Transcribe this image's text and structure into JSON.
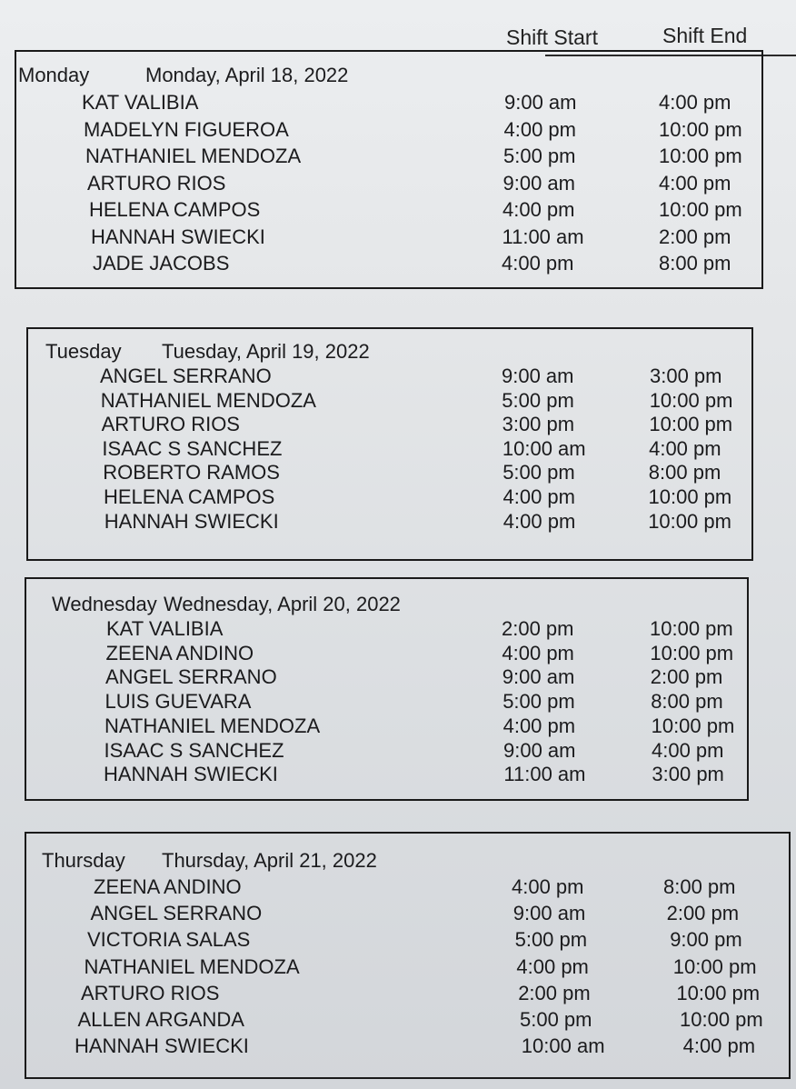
{
  "columns": {
    "start": "Shift Start",
    "end": "Shift End"
  },
  "days": [
    {
      "day": "Monday",
      "date": "Monday, April 18, 2022",
      "rows": [
        {
          "name": "KAT VALIBIA",
          "start": "9:00 am",
          "end": "4:00 pm"
        },
        {
          "name": "MADELYN FIGUEROA",
          "start": "4:00 pm",
          "end": "10:00 pm"
        },
        {
          "name": "NATHANIEL MENDOZA",
          "start": "5:00 pm",
          "end": "10:00 pm"
        },
        {
          "name": "ARTURO RIOS",
          "start": "9:00 am",
          "end": "4:00 pm"
        },
        {
          "name": "HELENA CAMPOS",
          "start": "4:00 pm",
          "end": "10:00 pm"
        },
        {
          "name": "HANNAH SWIECKI",
          "start": "11:00 am",
          "end": "2:00 pm"
        },
        {
          "name": "JADE JACOBS",
          "start": "4:00 pm",
          "end": "8:00 pm"
        }
      ]
    },
    {
      "day": "Tuesday",
      "date": "Tuesday, April 19, 2022",
      "rows": [
        {
          "name": "ANGEL SERRANO",
          "start": "9:00 am",
          "end": "3:00 pm"
        },
        {
          "name": "NATHANIEL MENDOZA",
          "start": "5:00 pm",
          "end": "10:00 pm"
        },
        {
          "name": "ARTURO RIOS",
          "start": "3:00 pm",
          "end": "10:00 pm"
        },
        {
          "name": "ISAAC S SANCHEZ",
          "start": "10:00 am",
          "end": "4:00 pm"
        },
        {
          "name": "ROBERTO RAMOS",
          "start": "5:00 pm",
          "end": "8:00 pm"
        },
        {
          "name": "HELENA CAMPOS",
          "start": "4:00 pm",
          "end": "10:00 pm"
        },
        {
          "name": "HANNAH SWIECKI",
          "start": "4:00 pm",
          "end": "10:00 pm"
        }
      ]
    },
    {
      "day": "Wednesday",
      "date": "Wednesday, April 20, 2022",
      "rows": [
        {
          "name": "KAT VALIBIA",
          "start": "2:00 pm",
          "end": "10:00 pm"
        },
        {
          "name": "ZEENA ANDINO",
          "start": "4:00 pm",
          "end": "10:00 pm"
        },
        {
          "name": "ANGEL SERRANO",
          "start": "9:00 am",
          "end": "2:00 pm"
        },
        {
          "name": "LUIS GUEVARA",
          "start": "5:00 pm",
          "end": "8:00 pm"
        },
        {
          "name": "NATHANIEL MENDOZA",
          "start": "4:00 pm",
          "end": "10:00 pm"
        },
        {
          "name": "ISAAC S SANCHEZ",
          "start": "9:00 am",
          "end": "4:00 pm"
        },
        {
          "name": "HANNAH SWIECKI",
          "start": "11:00 am",
          "end": "3:00 pm"
        }
      ]
    },
    {
      "day": "Thursday",
      "date": "Thursday, April 21, 2022",
      "rows": [
        {
          "name": "ZEENA ANDINO",
          "start": "4:00 pm",
          "end": "8:00 pm"
        },
        {
          "name": "ANGEL SERRANO",
          "start": "9:00 am",
          "end": "2:00 pm"
        },
        {
          "name": "VICTORIA SALAS",
          "start": "5:00 pm",
          "end": "9:00 pm"
        },
        {
          "name": "NATHANIEL MENDOZA",
          "start": "4:00 pm",
          "end": "10:00 pm"
        },
        {
          "name": "ARTURO RIOS",
          "start": "2:00 pm",
          "end": "10:00 pm"
        },
        {
          "name": "ALLEN ARGANDA",
          "start": "5:00 pm",
          "end": "10:00 pm"
        },
        {
          "name": "HANNAH SWIECKI",
          "start": "10:00 am",
          "end": "4:00 pm"
        }
      ]
    }
  ]
}
